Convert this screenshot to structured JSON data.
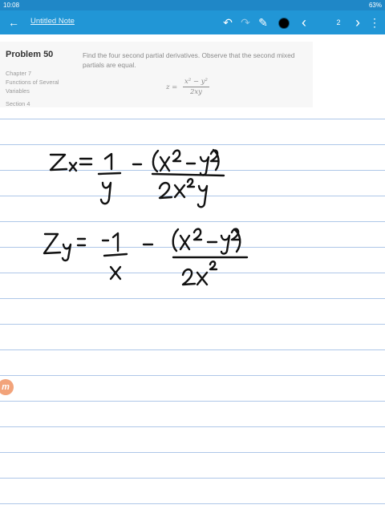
{
  "status_bar": {
    "time": "10:08",
    "battery": "63%"
  },
  "toolbar": {
    "back_icon": "←",
    "title": "Untitled Note",
    "undo_icon": "↶",
    "redo_icon": "↷",
    "pen_icon": "✎",
    "pen_color": "#000000",
    "prev_icon": "‹",
    "page_number": "2",
    "next_icon": "›",
    "menu_icon": "⋮"
  },
  "problem": {
    "number": "Problem 50",
    "chapter": "Chapter 7",
    "topic_line1": "Functions of Several",
    "topic_line2": "Variables",
    "section": "Section 4",
    "description": "Find the four second partial derivatives. Observe that the second mixed partials are equal.",
    "formula_lhs": "z =",
    "formula_numerator": "x² − y²",
    "formula_denominator": "2xy"
  },
  "logo_letter": "m"
}
